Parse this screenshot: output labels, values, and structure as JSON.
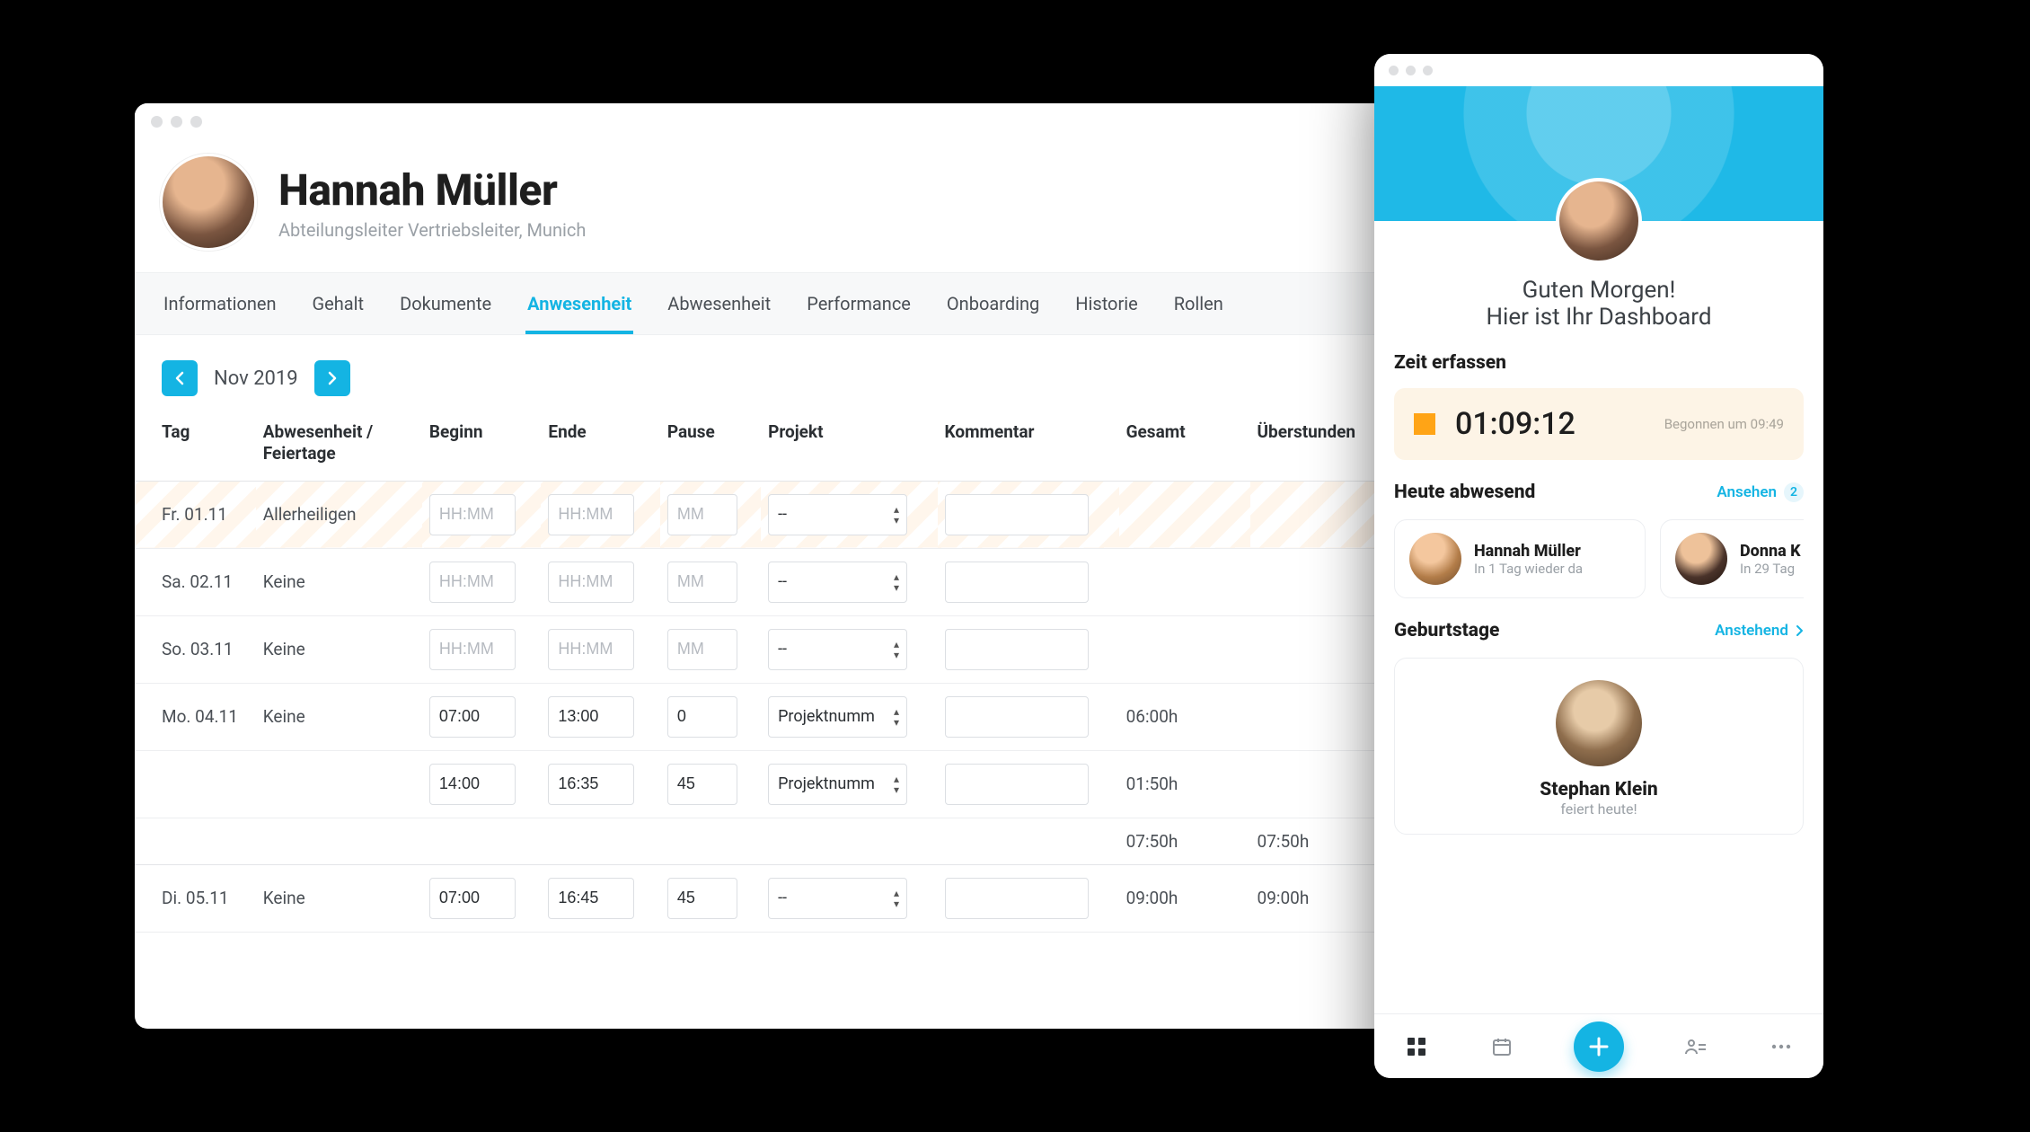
{
  "profile": {
    "name": "Hannah Müller",
    "subtitle": "Abteilungsleiter Vertriebsleiter, Munich"
  },
  "tabs": {
    "informationen": "Informationen",
    "gehalt": "Gehalt",
    "dokumente": "Dokumente",
    "anwesenheit": "Anwesenheit",
    "abwesenheit": "Abwesenheit",
    "performance": "Performance",
    "onboarding": "Onboarding",
    "historie": "Historie",
    "rollen": "Rollen"
  },
  "month_nav": {
    "label": "Nov 2019"
  },
  "columns": {
    "tag": "Tag",
    "abwesenheit": "Abwesenheit / Feiertage",
    "beginn": "Beginn",
    "ende": "Ende",
    "pause": "Pause",
    "projekt": "Projekt",
    "kommentar": "Kommentar",
    "gesamt": "Gesamt",
    "ueberstunden": "Überstunden"
  },
  "placeholders": {
    "hhmm": "HH:MM",
    "mm": "MM",
    "proj_empty": "--",
    "proj_filled": "Projektnumm"
  },
  "rows": [
    {
      "dow": "Fr.",
      "date": "01.11",
      "absence": "Allerheiligen",
      "beginn": "",
      "ende": "",
      "pause": "",
      "projekt": "--",
      "holiday": true
    },
    {
      "dow": "Sa.",
      "date": "02.11",
      "absence": "Keine",
      "beginn": "",
      "ende": "",
      "pause": "",
      "projekt": "--"
    },
    {
      "dow": "So.",
      "date": "03.11",
      "absence": "Keine",
      "beginn": "",
      "ende": "",
      "pause": "",
      "projekt": "--"
    },
    {
      "dow": "Mo.",
      "date": "04.11",
      "absence": "Keine",
      "beginn": "07:00",
      "ende": "13:00",
      "pause": "0",
      "projekt": "Projektnumm",
      "gesamt": "06:00h"
    },
    {
      "dow": "",
      "date": "",
      "absence": "",
      "beginn": "14:00",
      "ende": "16:35",
      "pause": "45",
      "projekt": "Projektnumm",
      "gesamt": "01:50h"
    },
    {
      "sum": true,
      "gesamt": "07:50h",
      "ueberstunden": "07:50h"
    },
    {
      "dow": "Di.",
      "date": "05.11",
      "absence": "Keine",
      "beginn": "07:00",
      "ende": "16:45",
      "pause": "45",
      "projekt": "--",
      "gesamt": "09:00h",
      "ueberstunden": "09:00h"
    }
  ],
  "mobile": {
    "greeting1": "Guten Morgen!",
    "greeting2": "Hier ist Ihr Dashboard",
    "time_section_title": "Zeit erfassen",
    "timer": "01:09:12",
    "started": "Begonnen um 09:49",
    "absent_title": "Heute abwesend",
    "absent_link": "Ansehen",
    "absent_count": "2",
    "absent": [
      {
        "name": "Hannah Müller",
        "sub": "In 1 Tag wieder da"
      },
      {
        "name": "Donna K",
        "sub": "In 29 Tag"
      }
    ],
    "birthdays_title": "Geburtstage",
    "birthdays_link": "Anstehend",
    "birthday_name": "Stephan Klein",
    "birthday_sub": "feiert heute!"
  }
}
